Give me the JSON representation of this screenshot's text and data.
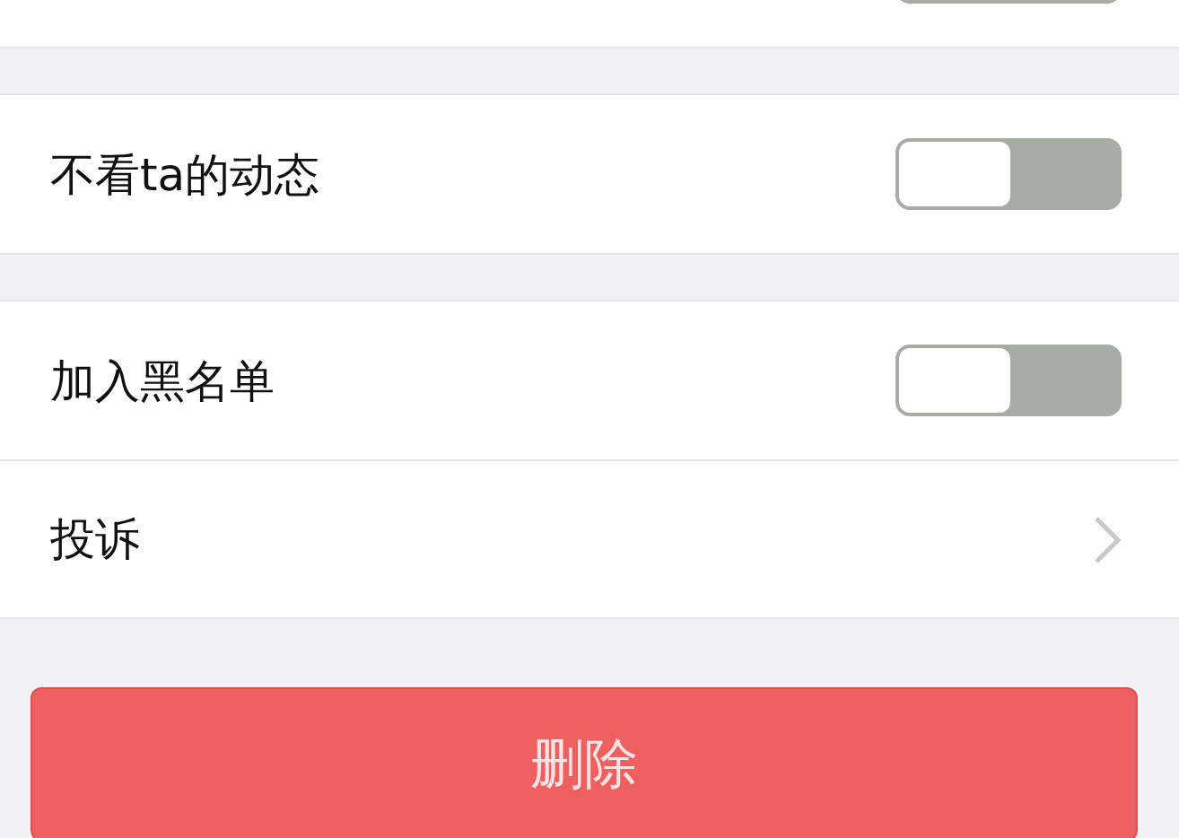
{
  "sections": [
    {
      "items": [
        {
          "kind": "toggle",
          "on": false
        }
      ]
    },
    {
      "items": [
        {
          "kind": "toggle",
          "label": "不看ta的动态",
          "on": false
        }
      ]
    },
    {
      "items": [
        {
          "kind": "toggle",
          "label": "加入黑名单",
          "on": false
        },
        {
          "kind": "link",
          "label": "投诉"
        }
      ]
    }
  ],
  "delete_button": {
    "label": "删除"
  }
}
